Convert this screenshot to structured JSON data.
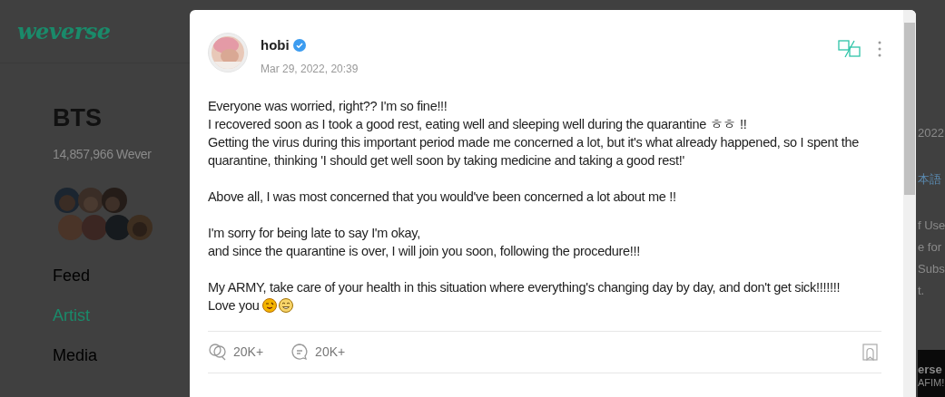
{
  "header": {
    "logo": "weverse"
  },
  "community": {
    "name": "BTS",
    "members": "14,857,966 Wever"
  },
  "nav": [
    {
      "label": "Feed",
      "selected": false
    },
    {
      "label": "Artist",
      "selected": true
    },
    {
      "label": "Media",
      "selected": false
    }
  ],
  "background_fragments": [
    "2022",
    "本語",
    "f Use",
    "e for",
    "Subs",
    "t."
  ],
  "background_banner": [
    "erse",
    "AFIM!"
  ],
  "post": {
    "author": "hobi",
    "verified": true,
    "date": "Mar 29, 2022, 20:39",
    "paragraphs": [
      [
        "Everyone was worried, right?? I'm so fine!!!",
        "I recovered soon as I took a good rest, eating well and sleeping well during the quarantine ㅎㅎ !!",
        "Getting the virus during this important period made me concerned a lot, but it's what already happened, so I spent the quarantine, thinking 'I should get well soon by taking medicine and taking a good rest!'"
      ],
      [
        "Above all, I was most concerned that you would've been concerned a lot about me !!"
      ],
      [
        "I'm sorry for being late to say I'm okay,",
        "and since the quarantine is over, I will join you soon, following the procedure!!!"
      ],
      [
        "My ARMY, take care of your health in this situation where everything's changing day by day, and don't get sick!!!!!!!",
        "Love you"
      ]
    ],
    "likes": "20K+",
    "comments": "20K+"
  }
}
